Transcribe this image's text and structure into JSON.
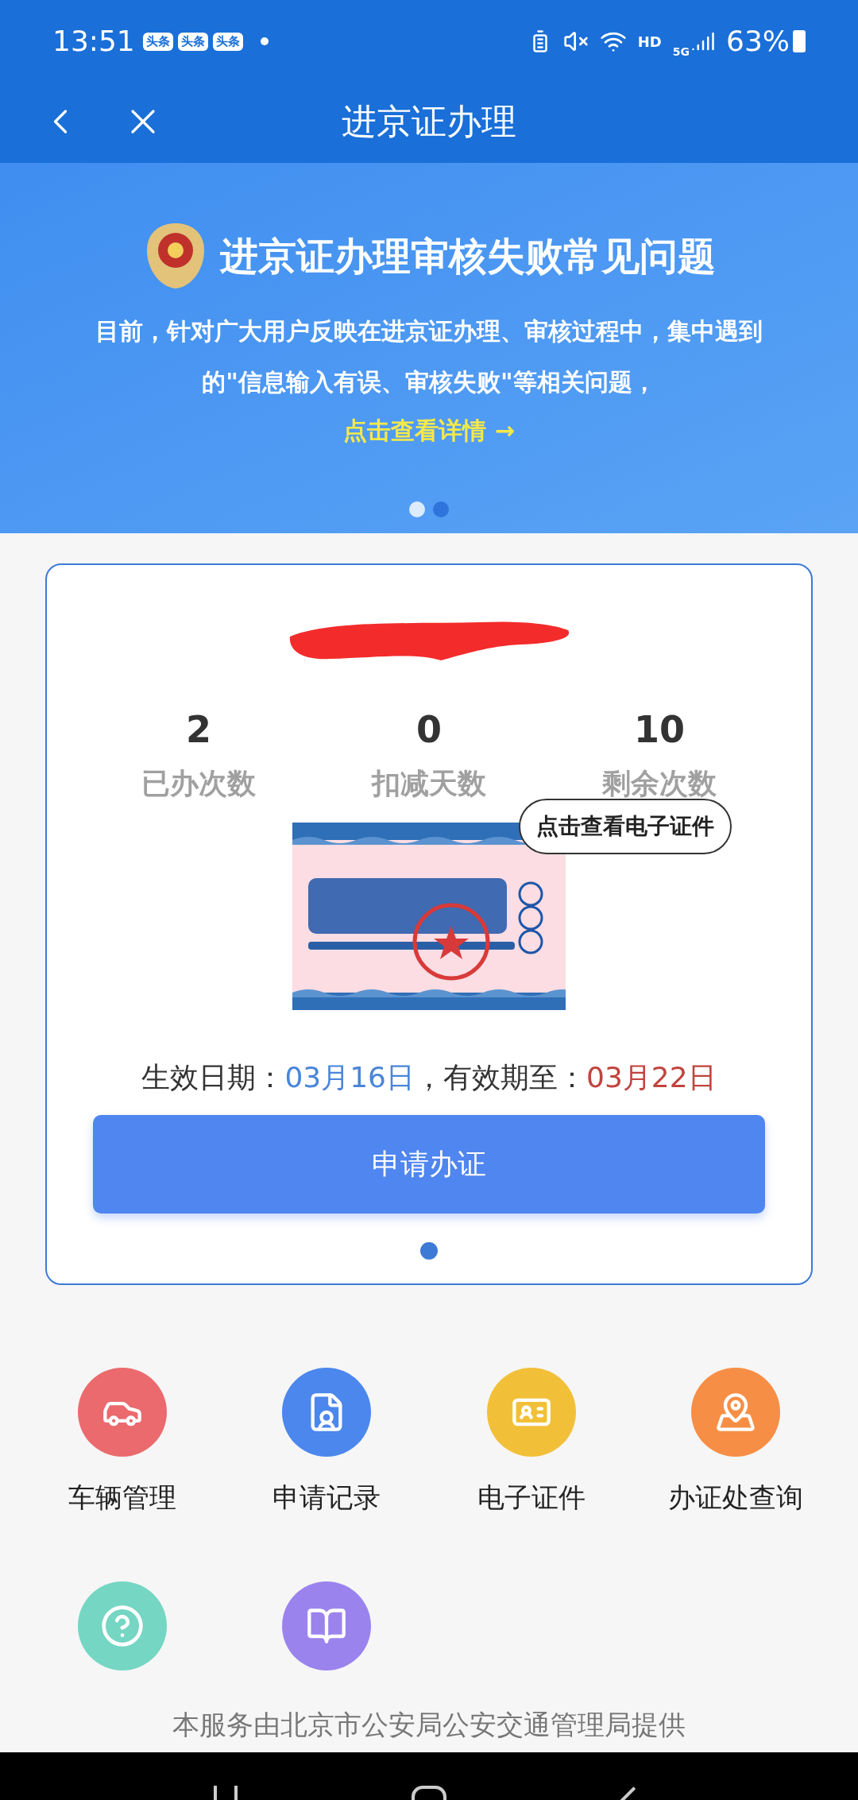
{
  "status_bar": {
    "time": "13:51",
    "notification_badges": [
      "头条",
      "头条",
      "头条"
    ],
    "network": "HD",
    "signal_type": "5G",
    "battery": "63%"
  },
  "nav": {
    "title": "进京证办理"
  },
  "banner": {
    "title": "进京证办理审核失败常见问题",
    "body": "目前，针对广大用户反映在进京证办理、审核过程中，集中遇到的\"信息输入有误、审核失败\"等相关问题，",
    "link": "点击查看详情 →",
    "pages": [
      {
        "selected": true
      },
      {
        "selected": false
      }
    ]
  },
  "card": {
    "stats": [
      {
        "value": "2",
        "label": "已办次数"
      },
      {
        "value": "0",
        "label": "扣减天数"
      },
      {
        "value": "10",
        "label": "剩余次数"
      }
    ],
    "tooltip": "点击查看电子证件",
    "dates": {
      "start_label": "生效日期：",
      "start": "03月16日",
      "sep": "，有效期至：",
      "end": "03月22日"
    },
    "apply_button": "申请办证",
    "pages": [
      {
        "selected": true
      }
    ]
  },
  "services": [
    {
      "kind": "car",
      "label": "车辆管理",
      "color": "#ea6a6e"
    },
    {
      "kind": "record",
      "label": "申请记录",
      "color": "#4b87ec"
    },
    {
      "kind": "idcard",
      "label": "电子证件",
      "color": "#f2c038"
    },
    {
      "kind": "location",
      "label": "办证处查询",
      "color": "#f78e45"
    },
    {
      "kind": "help",
      "color": "#74d6c3"
    },
    {
      "kind": "book",
      "color": "#9b83ee"
    }
  ],
  "footer": "本服务由北京市公安局公安交通管理局提供"
}
